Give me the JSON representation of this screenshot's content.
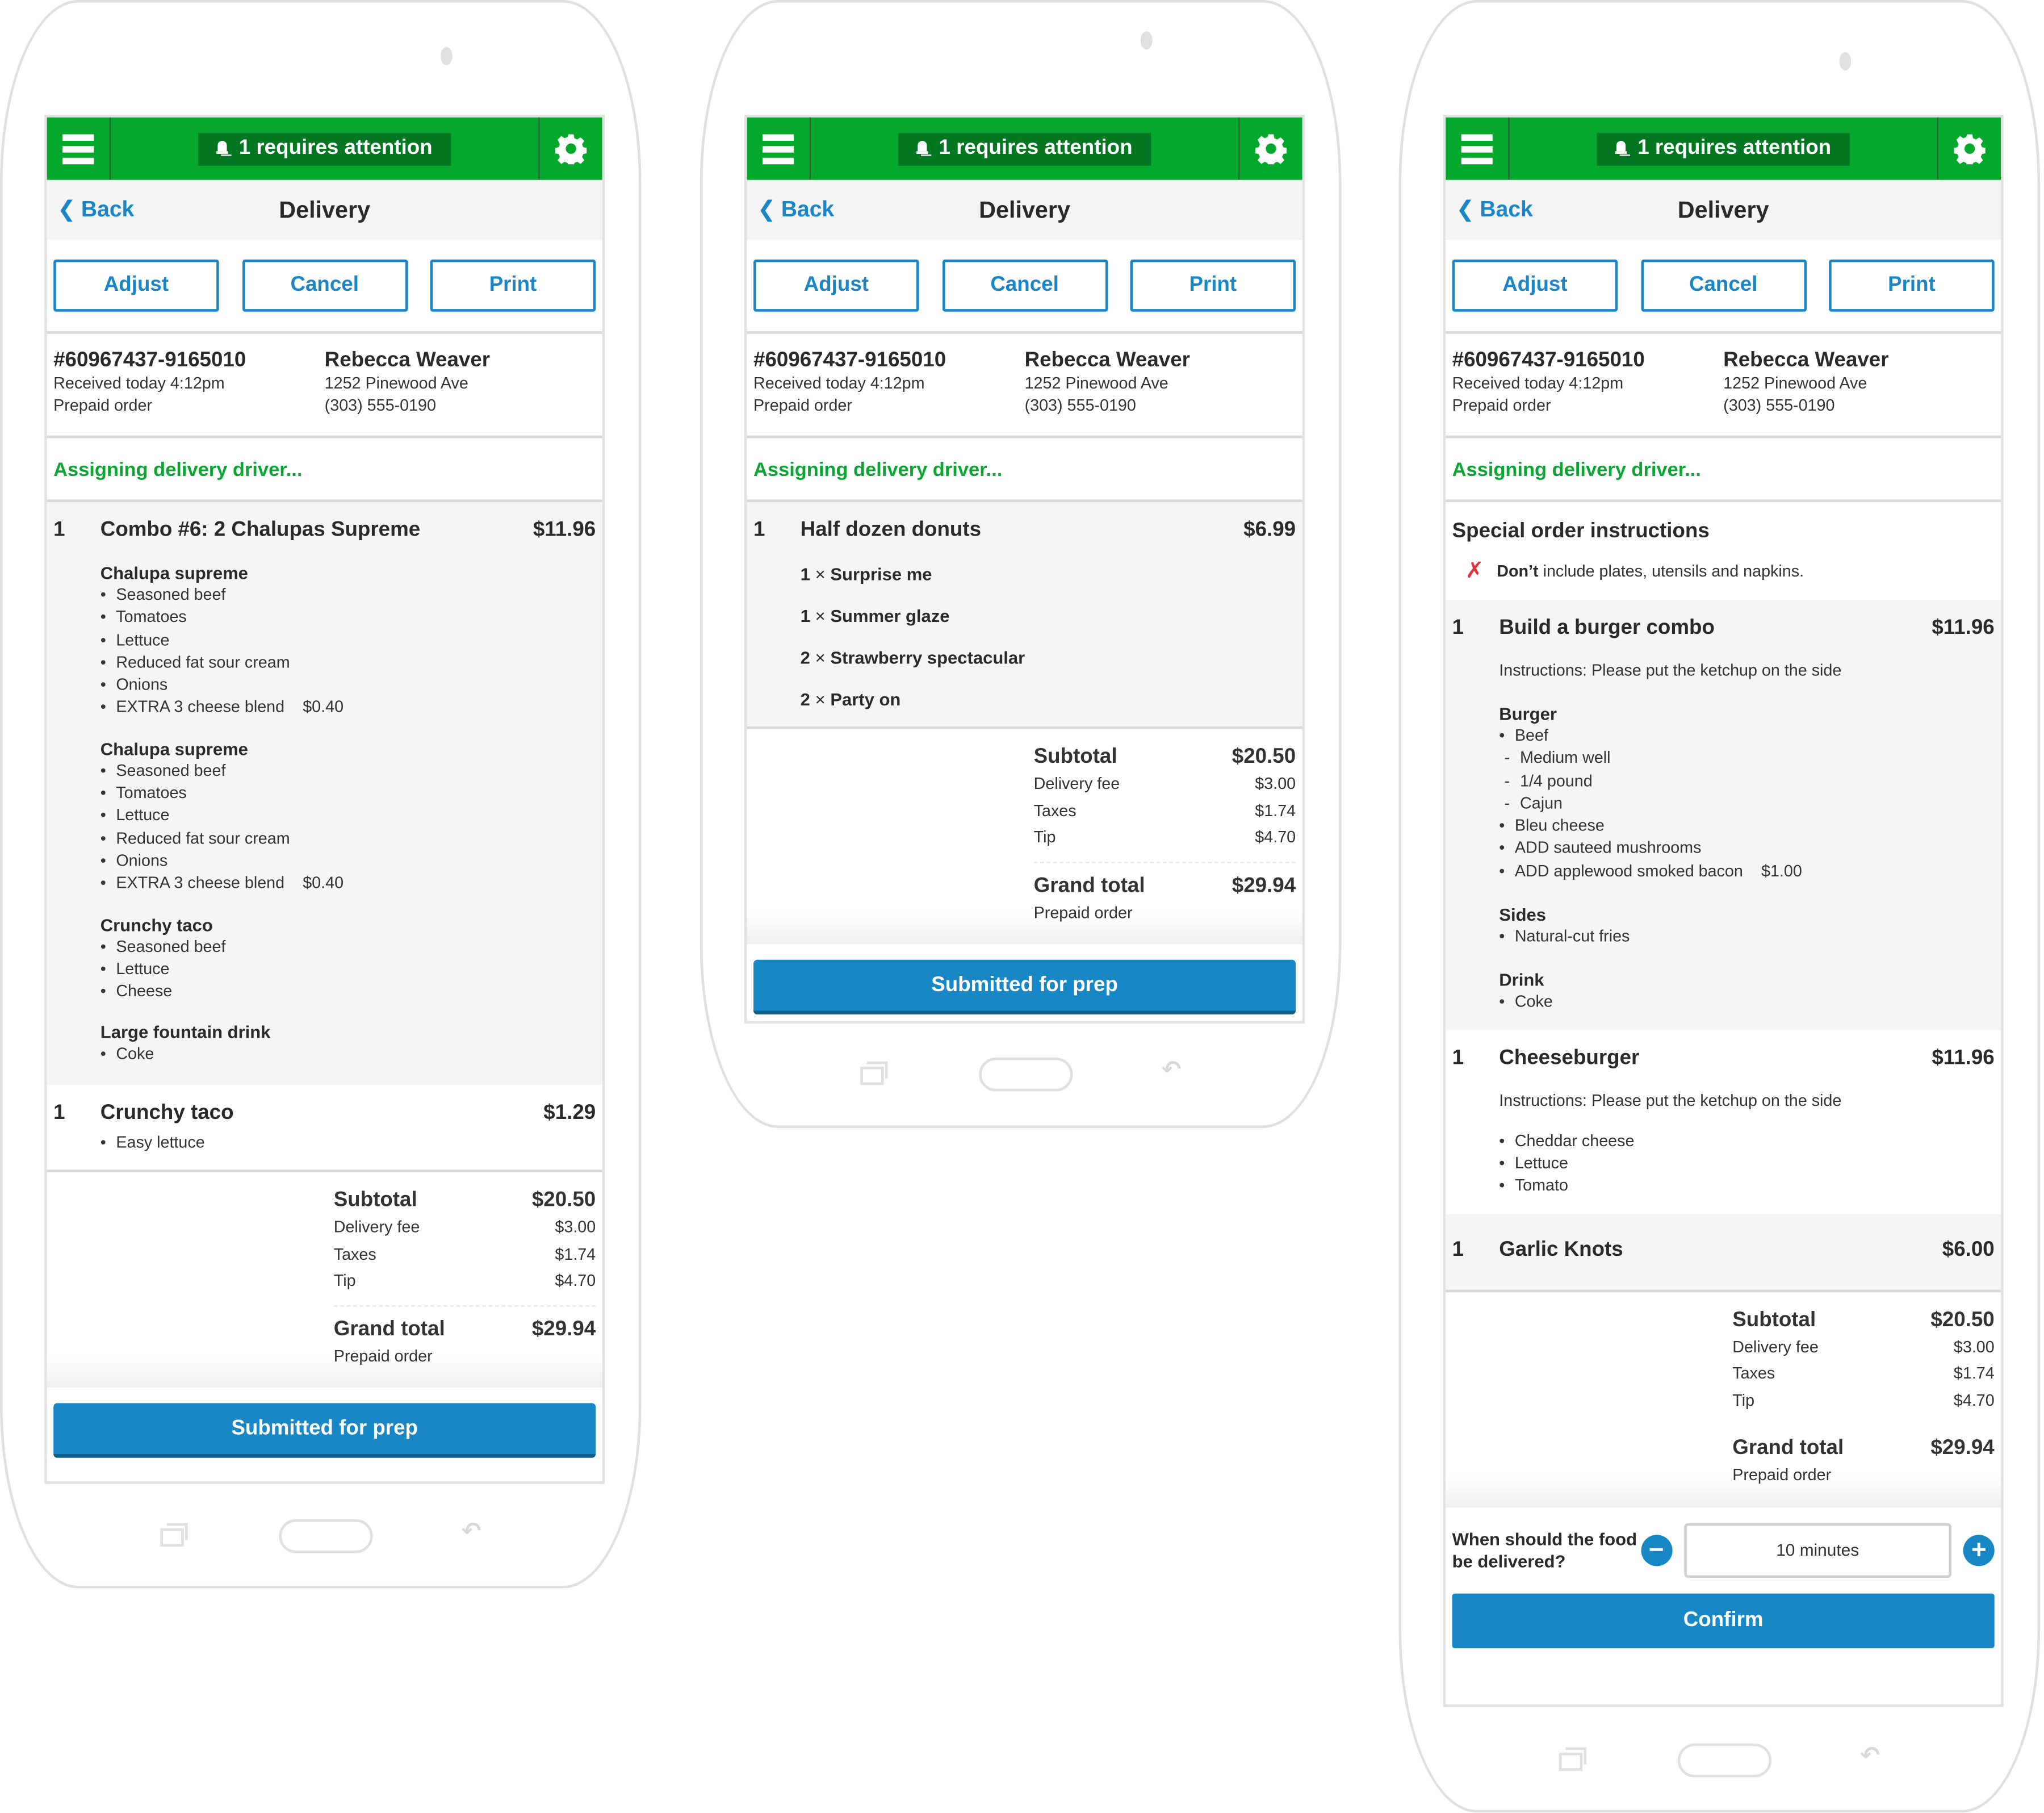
{
  "common": {
    "attention_label": "1 requires attention",
    "back_label": "Back",
    "page_title": "Delivery",
    "actions": [
      "Adjust",
      "Cancel",
      "Print"
    ],
    "order_id": "#60967437-9165010",
    "received": "Received today 4:12pm",
    "payment": "Prepaid order",
    "customer_name": "Rebecca Weaver",
    "address": "1252 Pinewood Ave",
    "phone": "(303) 555-0190",
    "status": "Assigning delivery driver...",
    "totals": {
      "subtotal_label": "Subtotal",
      "subtotal": "$20.50",
      "delivery_label": "Delivery fee",
      "delivery": "$3.00",
      "taxes_label": "Taxes",
      "taxes": "$1.74",
      "tip_label": "Tip",
      "tip": "$4.70",
      "grand_label": "Grand total",
      "grand": "$29.94",
      "grand_note": "Prepaid order"
    },
    "colors": {
      "brand_green": "#04a82c",
      "attention_bg": "#027620",
      "accent_blue": "#1887c6",
      "status_green": "#0aa631",
      "error_red": "#e8303c"
    }
  },
  "phone1": {
    "items": [
      {
        "qty": "1",
        "name": "Combo #6: 2 Chalupas Supreme",
        "price": "$11.96",
        "groups": [
          {
            "title": "Chalupa supreme",
            "mods": [
              "Seasoned beef",
              "Tomatoes",
              "Lettuce",
              "Reduced fat sour cream",
              "Onions",
              "EXTRA 3 cheese blend"
            ],
            "extra_price": "$0.40"
          },
          {
            "title": "Chalupa supreme",
            "mods": [
              "Seasoned beef",
              "Tomatoes",
              "Lettuce",
              "Reduced fat sour cream",
              "Onions",
              "EXTRA 3 cheese blend"
            ],
            "extra_price": "$0.40"
          },
          {
            "title": "Crunchy taco",
            "mods": [
              "Seasoned beef",
              "Lettuce",
              "Cheese"
            ]
          },
          {
            "title": "Large fountain drink",
            "mods": [
              "Coke"
            ]
          }
        ]
      },
      {
        "qty": "1",
        "name": "Crunchy taco",
        "price": "$1.29",
        "mods": [
          "Easy lettuce"
        ]
      }
    ],
    "primary_button": "Submitted for prep"
  },
  "phone2": {
    "items": [
      {
        "qty": "1",
        "name": "Half dozen donuts",
        "price": "$6.99",
        "donuts": [
          {
            "count": "1",
            "name": "Surprise me"
          },
          {
            "count": "1",
            "name": "Summer glaze"
          },
          {
            "count": "2",
            "name": "Strawberry spectacular"
          },
          {
            "count": "2",
            "name": "Party on"
          }
        ]
      }
    ],
    "primary_button": "Submitted for prep"
  },
  "phone3": {
    "special": {
      "title": "Special order instructions",
      "dont_label": "Don’t",
      "text": "include plates, utensils and napkins."
    },
    "items": [
      {
        "qty": "1",
        "name": "Build a burger combo",
        "price": "$11.96",
        "instructions": "Instructions: Please put the ketchup on the side",
        "burger_title": "Burger",
        "burger_mods": [
          "Beef",
          "Medium well",
          "1/4 pound",
          "Cajun",
          "Bleu cheese",
          "ADD sauteed mushrooms",
          "ADD applewood smoked bacon"
        ],
        "bacon_price": "$1.00",
        "sides_title": "Sides",
        "sides": [
          "Natural-cut fries"
        ],
        "drink_title": "Drink",
        "drink": [
          "Coke"
        ]
      },
      {
        "qty": "1",
        "name": "Cheeseburger",
        "price": "$11.96",
        "instructions": "Instructions: Please put the ketchup on the side",
        "mods": [
          "Cheddar cheese",
          "Lettuce",
          "Tomato"
        ]
      },
      {
        "qty": "1",
        "name": "Garlic Knots",
        "price": "$6.00"
      }
    ],
    "when_label": "When should the food be delivered?",
    "when_value": "10 minutes",
    "confirm_button": "Confirm"
  }
}
